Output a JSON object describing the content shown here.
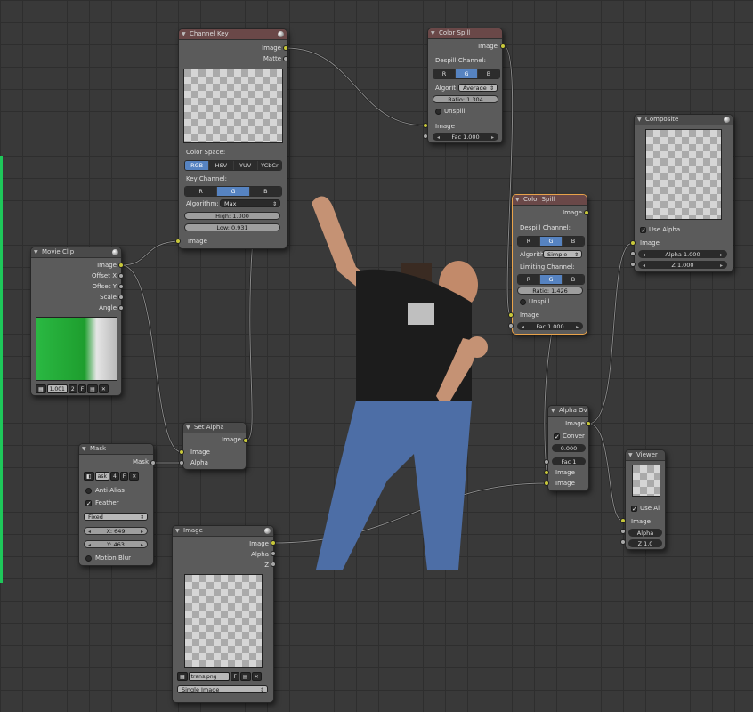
{
  "nodes": {
    "channel_key": {
      "title": "Channel Key",
      "outputs": [
        "Image",
        "Matte"
      ],
      "color_space_label": "Color Space:",
      "color_space_options": [
        "RGB",
        "HSV",
        "YUV",
        "YCbCr"
      ],
      "key_channel_label": "Key Channel:",
      "key_channel_options": [
        "R",
        "G",
        "B"
      ],
      "algorithm_label": "Algorithm:",
      "algorithm_value": "Max",
      "high": "High: 1.000",
      "low": "Low: 0.931",
      "input": "Image"
    },
    "color_spill_1": {
      "title": "Color Spill",
      "output": "Image",
      "despill_label": "Despill Channel:",
      "channels": [
        "R",
        "G",
        "B"
      ],
      "algorithm_label": "Algorit",
      "algorithm_value": "Average",
      "ratio": "Ratio: 1.304",
      "unspill": "Unspill",
      "input": "Image",
      "fac": "Fac 1.000"
    },
    "color_spill_2": {
      "title": "Color Spill",
      "output": "Image",
      "despill_label": "Despill Channel:",
      "channels": [
        "R",
        "G",
        "B"
      ],
      "algorithm_label": "Algorith",
      "algorithm_value": "Simple",
      "limiting_label": "Limiting Channel:",
      "limiting_channels": [
        "R",
        "G",
        "B"
      ],
      "ratio": "Ratio: 1.426",
      "unspill": "Unspill",
      "input": "Image",
      "fac": "Fac 1.000"
    },
    "composite": {
      "title": "Composite",
      "use_alpha": "Use Alpha",
      "input": "Image",
      "alpha": "Alpha 1.000",
      "z": "Z 1.000"
    },
    "movie_clip": {
      "title": "Movie Clip",
      "outputs": [
        "Image",
        "Offset X",
        "Offset Y",
        "Scale",
        "Angle"
      ],
      "clip_name": "1.001",
      "users": "2",
      "fake": "F"
    },
    "set_alpha": {
      "title": "Set Alpha",
      "output": "Image",
      "inputs": [
        "Image",
        "Alpha"
      ]
    },
    "mask": {
      "title": "Mask",
      "output": "Mask",
      "mask_name": "ask",
      "users": "4",
      "fake": "F",
      "anti_alias": "Anti-Alias",
      "feather": "Feather",
      "size_mode": "Fixed",
      "x": "X: 649",
      "y": "Y: 463",
      "motion_blur": "Motion Blur"
    },
    "image": {
      "title": "Image",
      "outputs": [
        "Image",
        "Alpha",
        "Z"
      ],
      "file": "trans.png",
      "fake": "F",
      "source": "Single Image"
    },
    "alpha_over": {
      "title": "Alpha Ov",
      "output": "Image",
      "convert": "Conver",
      "premul": "0.000",
      "fac": "Fac 1",
      "inputs": [
        "Image",
        "Image"
      ]
    },
    "viewer": {
      "title": "Viewer",
      "use_alpha": "Use Al",
      "input": "Image",
      "alpha": "Alpha",
      "z": "Z 1.0"
    }
  },
  "colors": {
    "background": "#393939",
    "node_body": "#5b5b5b",
    "socket_image": "#c8c83a",
    "socket_value": "#a8a8a8",
    "selected": "#5683c1",
    "active_outline": "#e8a24a"
  }
}
